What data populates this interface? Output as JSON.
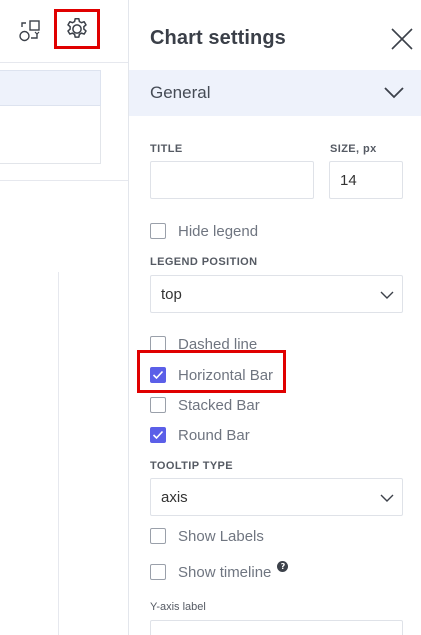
{
  "left_toolbar": {
    "shapes_icon": "shapes-icon",
    "settings_icon": "gear-icon"
  },
  "panel": {
    "title": "Chart settings",
    "close_icon": "close-icon",
    "section": {
      "title": "General",
      "expanded": true
    },
    "fields": {
      "title_label": "TITLE",
      "title_value": "",
      "size_label": "SIZE, px",
      "size_value": "14",
      "hide_legend_label": "Hide legend",
      "hide_legend_checked": false,
      "legend_position_label": "LEGEND POSITION",
      "legend_position_value": "top",
      "dashed_line_label": "Dashed line",
      "dashed_line_checked": false,
      "horizontal_bar_label": "Horizontal Bar",
      "horizontal_bar_checked": true,
      "stacked_bar_label": "Stacked Bar",
      "stacked_bar_checked": false,
      "round_bar_label": "Round Bar",
      "round_bar_checked": true,
      "tooltip_type_label": "TOOLTIP TYPE",
      "tooltip_type_value": "axis",
      "show_labels_label": "Show Labels",
      "show_labels_checked": false,
      "show_timeline_label": "Show timeline",
      "show_timeline_checked": false,
      "help_glyph": "?",
      "y_axis_label": "Y-axis label",
      "y_axis_value": ""
    }
  },
  "colors": {
    "accent": "#5b5fe8",
    "highlight": "#e00000",
    "section_bg": "#eef2fb"
  }
}
